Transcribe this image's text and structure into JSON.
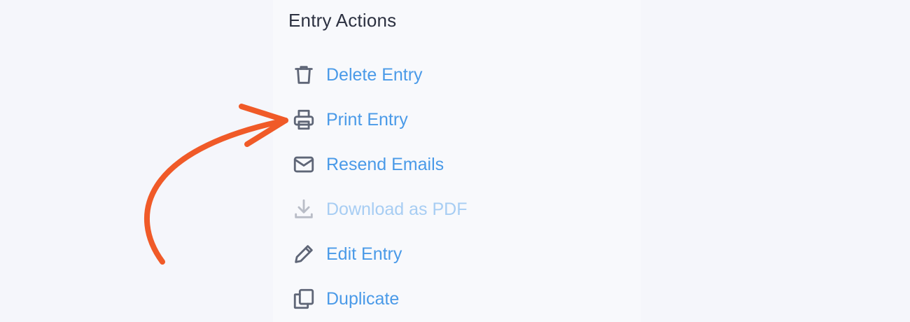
{
  "panel": {
    "title": "Entry Actions"
  },
  "colors": {
    "link": "#4a9ae8",
    "link_disabled": "#a7cdf3",
    "icon": "#5f6677",
    "icon_disabled": "#b9bdc7",
    "arrow": "#f05a28"
  },
  "actions": [
    {
      "label": "Delete Entry",
      "icon": "trash-icon",
      "disabled": false
    },
    {
      "label": "Print Entry",
      "icon": "printer-icon",
      "disabled": false
    },
    {
      "label": "Resend Emails",
      "icon": "envelope-icon",
      "disabled": false
    },
    {
      "label": "Download as PDF",
      "icon": "download-icon",
      "disabled": true
    },
    {
      "label": "Edit Entry",
      "icon": "pencil-icon",
      "disabled": false
    },
    {
      "label": "Duplicate",
      "icon": "duplicate-icon",
      "disabled": false
    }
  ]
}
